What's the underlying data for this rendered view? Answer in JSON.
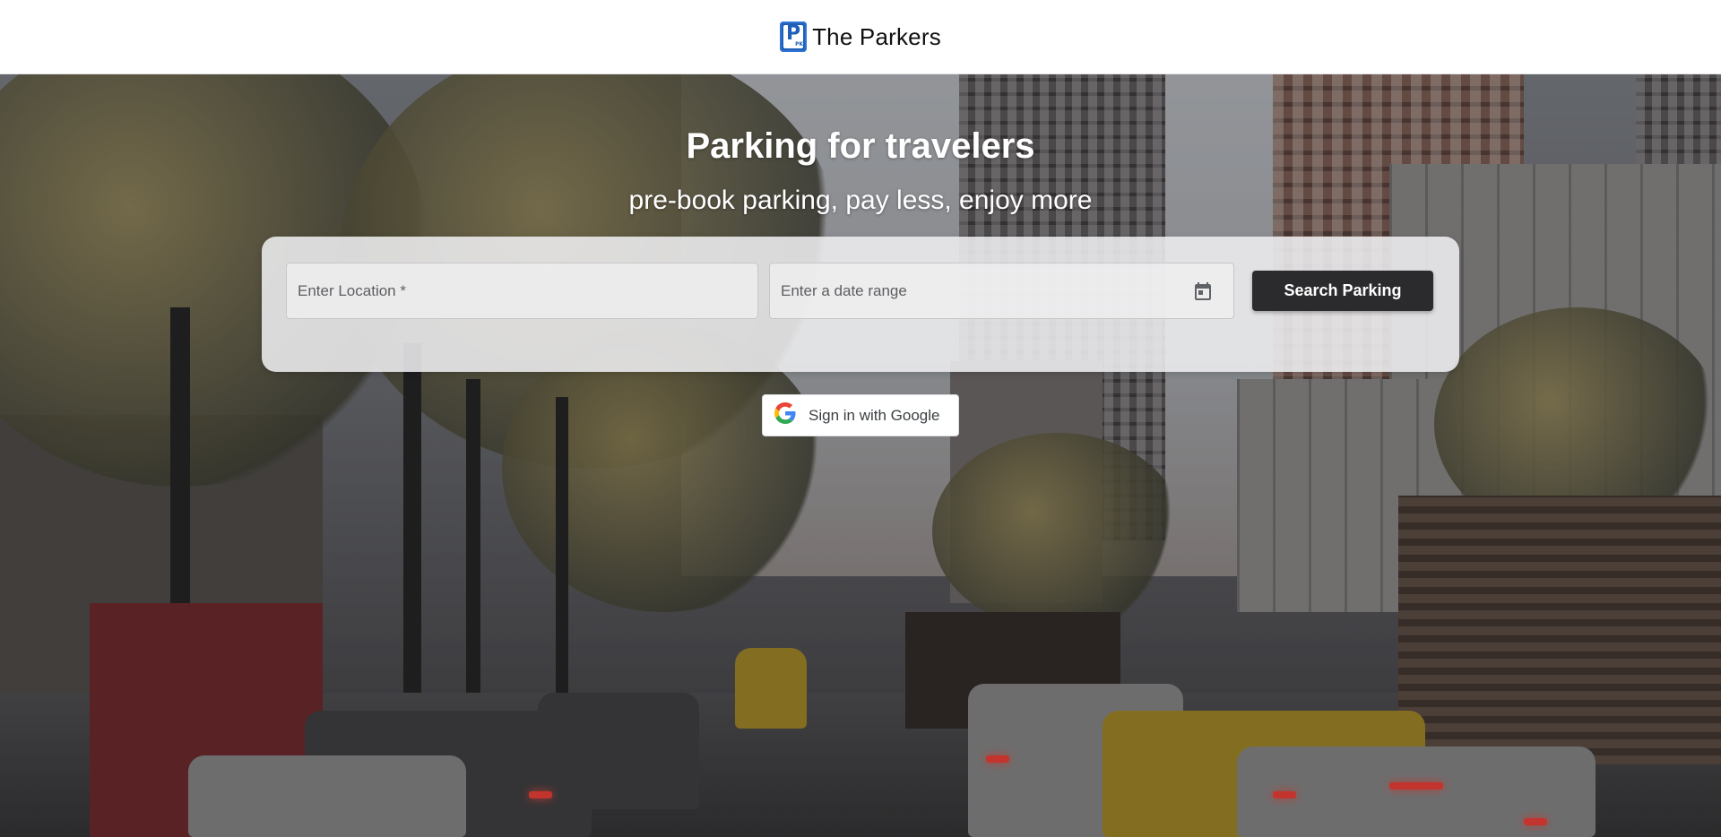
{
  "header": {
    "brand_name": "The Parkers",
    "logo_letter": "P",
    "logo_sub": "PK",
    "logo_icon": "parking-logo-icon",
    "brand_color": "#1f5fb7"
  },
  "hero": {
    "title": "Parking for travelers",
    "subtitle": "pre-book parking, pay less, enjoy more",
    "background": "city-street-traffic-photo"
  },
  "search": {
    "location_placeholder": "Enter Location *",
    "location_value": "",
    "dates_placeholder": "Enter a date range",
    "dates_value": "",
    "calendar_icon": "calendar-icon",
    "button_label": "Search Parking",
    "button_color": "#2b2b2e"
  },
  "auth": {
    "google_label": "Sign in with Google",
    "google_icon": "google-g-icon"
  }
}
